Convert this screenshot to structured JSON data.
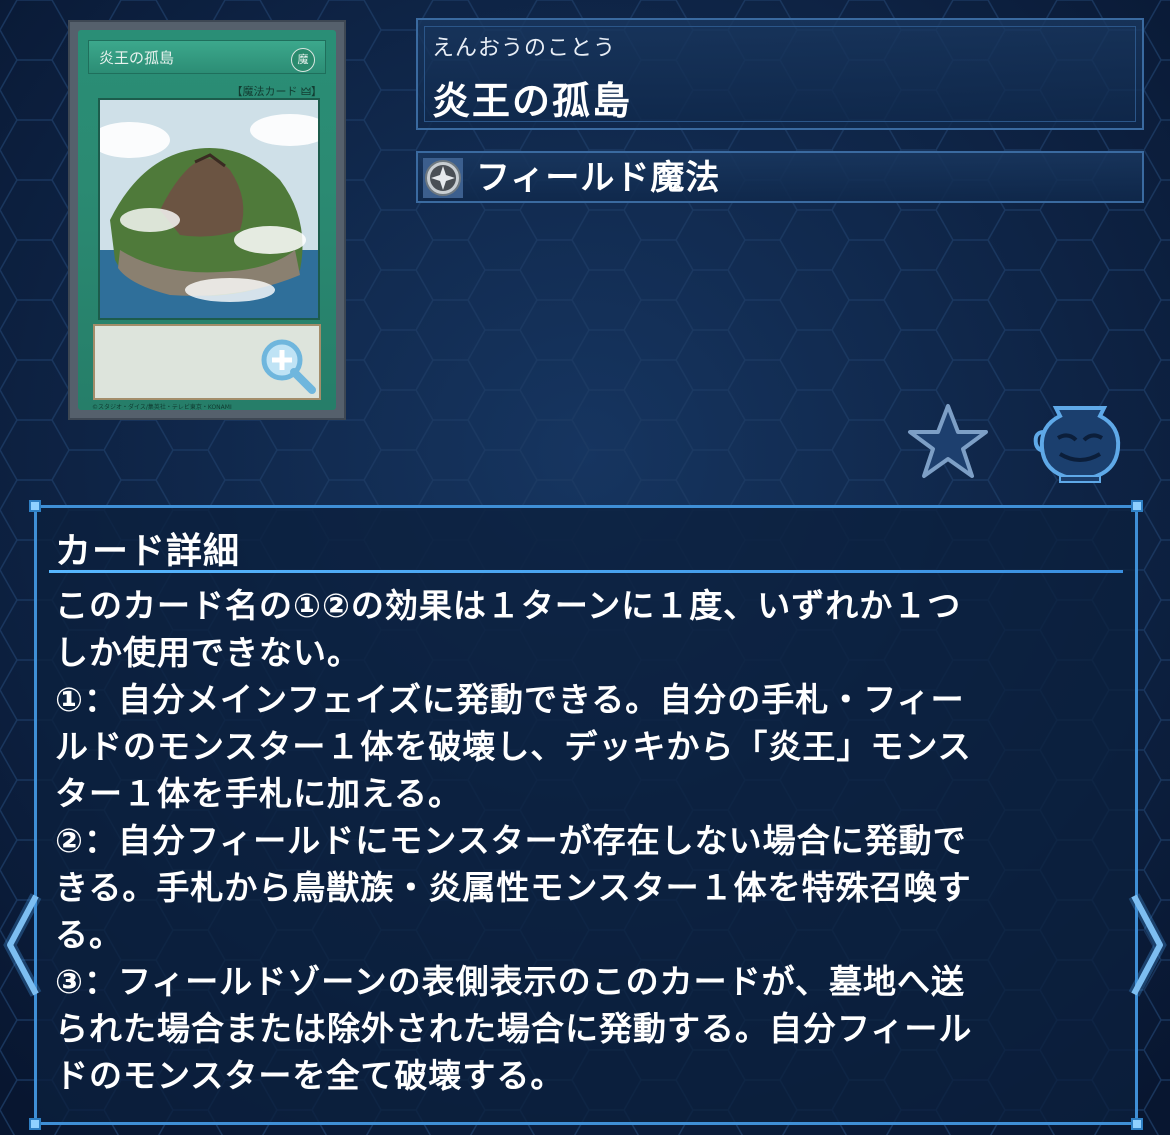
{
  "card": {
    "art_name": "炎王の孤島",
    "art_attribute": "魔",
    "art_type_line": "【魔法カード 🜲】",
    "art_copyright": "©スタジオ・ダイス/集英社・テレビ東京・KONAMI"
  },
  "header": {
    "reading": "えんおうのことう",
    "name": "炎王の孤島"
  },
  "type": {
    "icon": "field-spell-icon",
    "label": "フィールド魔法"
  },
  "actions": {
    "favorite_icon": "star-icon",
    "pot_icon": "pot-of-greed-icon"
  },
  "detail": {
    "title": "カード詳細",
    "text": "このカード名の①②の効果は１ターンに１度、いずれか１つ\nしか使用できない。\n①：自分メインフェイズに発動できる。自分の手札・フィー\nルドのモンスター１体を破壊し、デッキから「炎王」モンス\nター１体を手札に加える。\n②：自分フィールドにモンスターが存在しない場合に発動で\nきる。手札から鳥獣族・炎属性モンスター１体を特殊召喚す\nる。\n③：フィールドゾーンの表側表示のこのカードが、墓地へ送\nられた場合または除外された場合に発動する。自分フィール\nドのモンスターを全て破壊する。"
  },
  "nav": {
    "prev_icon": "chevron-left-icon",
    "next_icon": "chevron-right-icon"
  },
  "colors": {
    "background": "#0b1e3a",
    "panel_border": "#3f8fd6",
    "spell_green": "#2a8e76"
  }
}
